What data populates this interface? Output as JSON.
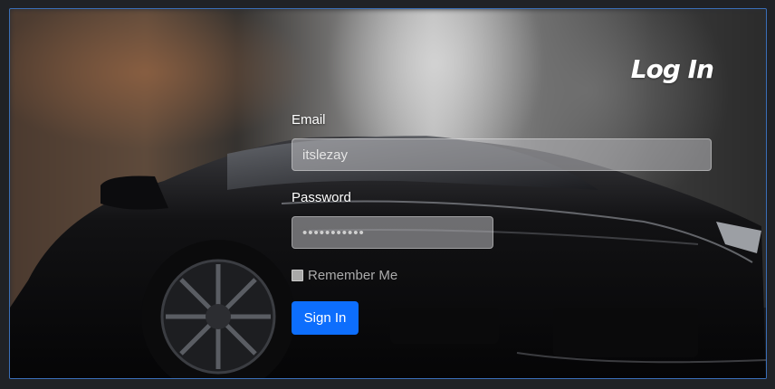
{
  "page": {
    "title": "Log In"
  },
  "form": {
    "email_label": "Email",
    "email_value": "itslezay",
    "password_label": "Password",
    "password_value": "•••••••••••",
    "remember_label": "Remember Me",
    "submit_label": "Sign In"
  },
  "colors": {
    "accent": "#0d6efd",
    "frame_border": "#3a6fb8",
    "page_background": "#202226"
  }
}
